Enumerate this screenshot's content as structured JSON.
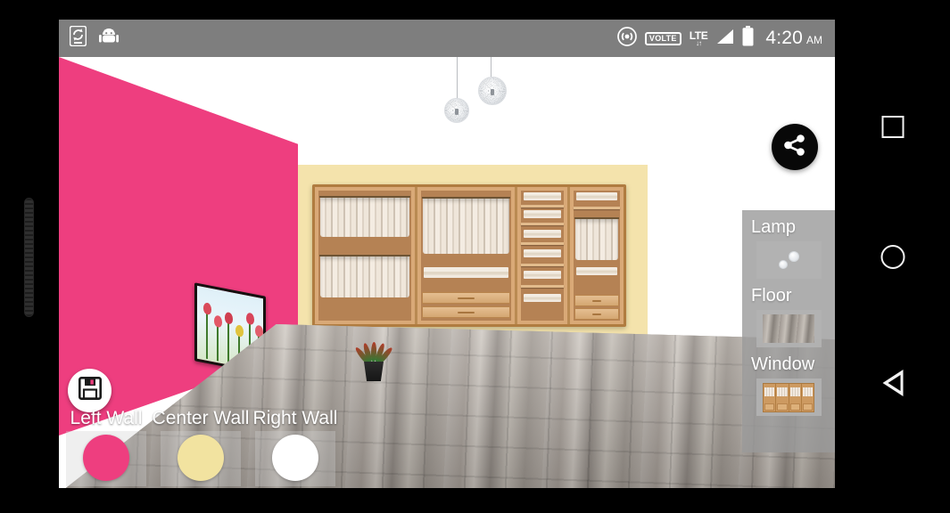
{
  "statusbar": {
    "left_icons": [
      {
        "name": "phone-sync-icon",
        "glyph": "phone-sync"
      },
      {
        "name": "android-head-icon",
        "glyph": "android"
      }
    ],
    "right_icons": [
      {
        "name": "hotspot-icon",
        "glyph": "hotspot"
      },
      {
        "name": "volte-badge",
        "label": "VOLTE"
      },
      {
        "name": "lte-icon",
        "label": "LTE",
        "arrows": "↓↑"
      },
      {
        "name": "signal-icon",
        "glyph": "signal-triangle"
      },
      {
        "name": "battery-icon",
        "glyph": "battery-full"
      }
    ],
    "time": "4:20",
    "ampm": "AM"
  },
  "scene": {
    "left_wall_color": "#ee3e7f",
    "center_wall_color": "#f4e3ac",
    "right_wall_color": "#ffffff",
    "floor_name": "weathered-wood-plank",
    "tv_image": "red-tulips",
    "lamp_count": 2,
    "wardrobe_name": "wooden-closet-wardrobe",
    "plant_name": "potted-plant"
  },
  "actions": {
    "save_label": "Save",
    "save_icon": "floppy-disk-icon",
    "share_label": "Share",
    "share_icon": "share-icon"
  },
  "object_panel": {
    "items": [
      {
        "label": "Lamp",
        "thumb": "pendant-lamp-thumbnail"
      },
      {
        "label": "Floor",
        "thumb": "wood-floor-thumbnail"
      },
      {
        "label": "Window",
        "thumb": "wardrobe-thumbnail"
      }
    ]
  },
  "wall_picker": {
    "options": [
      {
        "label": "Left Wall",
        "color": "#ee3e7f"
      },
      {
        "label": "Center Wall",
        "color": "#f2e3a0"
      },
      {
        "label": "Right Wall",
        "color": "#ffffff"
      }
    ]
  },
  "navbar": {
    "recents_label": "Recents",
    "home_label": "Home",
    "back_label": "Back"
  }
}
